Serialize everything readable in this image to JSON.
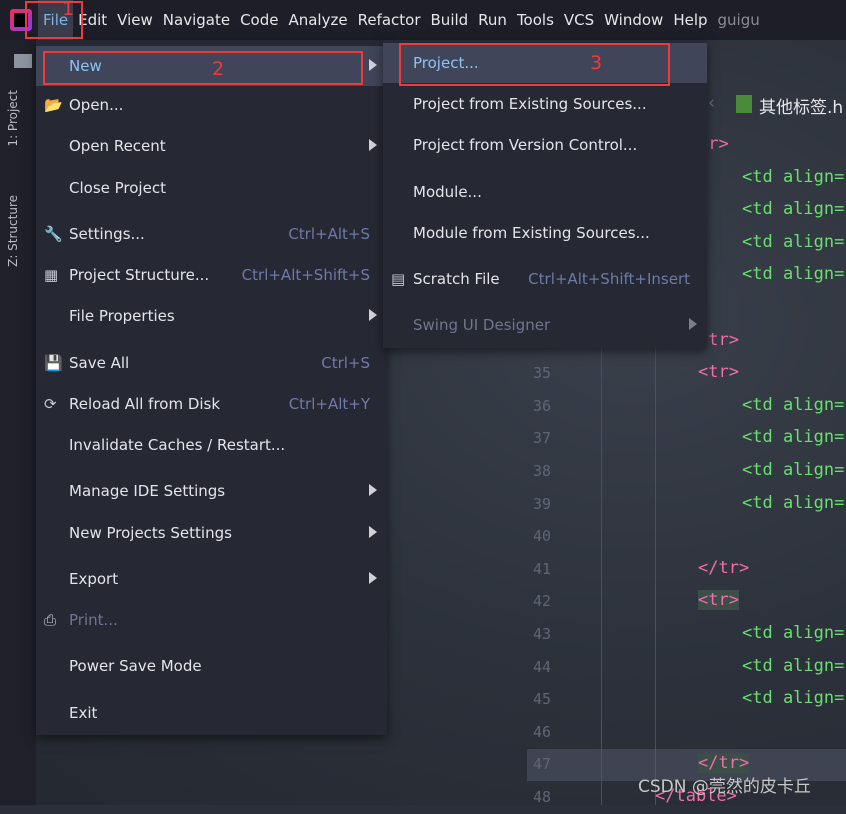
{
  "menubar": {
    "items": [
      "File",
      "Edit",
      "View",
      "Navigate",
      "Code",
      "Analyze",
      "Refactor",
      "Build",
      "Run",
      "Tools",
      "VCS",
      "Window",
      "Help"
    ],
    "title_fragment": "guigu"
  },
  "toolstrip": {
    "project": "1: Project",
    "structure": "Z: Structure"
  },
  "editor_tab": {
    "label": "其他标签.h"
  },
  "file_menu": [
    {
      "label": "New",
      "arrow": true,
      "selected": true
    },
    {
      "label": "Open...",
      "icon": "folder-open-icon"
    },
    {
      "label": "Open Recent",
      "arrow": true
    },
    {
      "label": "Close Project"
    },
    {
      "label": "Settings...",
      "shortcut": "Ctrl+Alt+S",
      "icon": "wrench-icon"
    },
    {
      "label": "Project Structure...",
      "shortcut": "Ctrl+Alt+Shift+S",
      "icon": "project-structure-icon"
    },
    {
      "label": "File Properties",
      "arrow": true
    },
    {
      "label": "Save All",
      "shortcut": "Ctrl+S",
      "icon": "save-icon"
    },
    {
      "label": "Reload All from Disk",
      "shortcut": "Ctrl+Alt+Y",
      "icon": "reload-icon"
    },
    {
      "label": "Invalidate Caches / Restart..."
    },
    {
      "label": "Manage IDE Settings",
      "arrow": true
    },
    {
      "label": "New Projects Settings",
      "arrow": true
    },
    {
      "label": "Export",
      "arrow": true
    },
    {
      "label": "Print...",
      "disabled": true,
      "icon": "print-icon"
    },
    {
      "label": "Power Save Mode"
    },
    {
      "label": "Exit"
    }
  ],
  "new_submenu": [
    {
      "label": "Project...",
      "selected": true
    },
    {
      "label": "Project from Existing Sources..."
    },
    {
      "label": "Project from Version Control..."
    },
    {
      "label": "Module..."
    },
    {
      "label": "Module from Existing Sources..."
    },
    {
      "label": "Scratch File",
      "shortcut": "Ctrl+Alt+Shift+Insert",
      "icon": "scratch-file-icon"
    },
    {
      "label": "Swing UI Designer",
      "arrow": true,
      "disabled": true
    }
  ],
  "annotations": [
    "1",
    "2",
    "3"
  ],
  "code_lines": [
    {
      "n": "",
      "code": "tr>"
    },
    {
      "n": "",
      "code": "<td align="
    },
    {
      "n": "",
      "code": "<td align="
    },
    {
      "n": "",
      "code": "<td align="
    },
    {
      "n": "",
      "code": "<td align="
    },
    {
      "n": "",
      "code": ""
    },
    {
      "n": "",
      "code": "/tr>"
    },
    {
      "n": "35",
      "code": "<tr>"
    },
    {
      "n": "36",
      "code": "<td align="
    },
    {
      "n": "37",
      "code": "<td align="
    },
    {
      "n": "38",
      "code": "<td align="
    },
    {
      "n": "39",
      "code": "<td align="
    },
    {
      "n": "40",
      "code": ""
    },
    {
      "n": "41",
      "code": "</tr>"
    },
    {
      "n": "42",
      "code": "<tr>"
    },
    {
      "n": "43",
      "code": "<td align="
    },
    {
      "n": "44",
      "code": "<td align="
    },
    {
      "n": "45",
      "code": "<td align="
    },
    {
      "n": "46",
      "code": ""
    },
    {
      "n": "47",
      "code": "</tr>"
    },
    {
      "n": "48",
      "code": "</table>"
    }
  ],
  "watermark": "CSDN @莞然的皮卡丘"
}
